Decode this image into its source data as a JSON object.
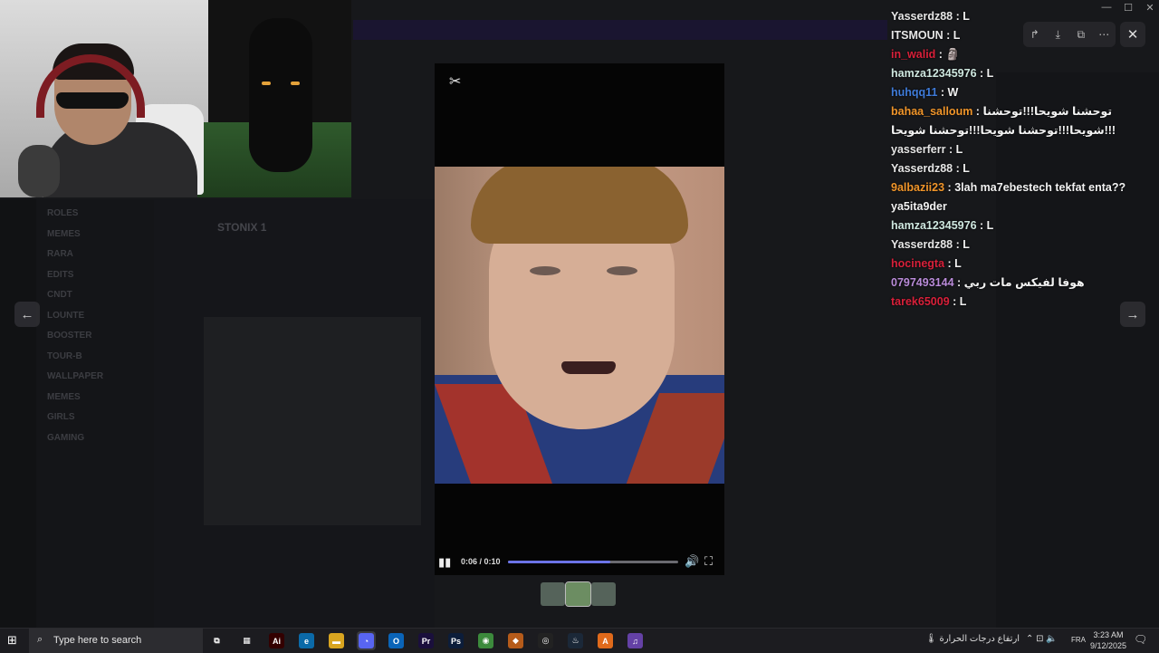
{
  "background_app": {
    "title": "STONIX 1",
    "channels": [
      "ROLES",
      "MEMES",
      "RARA",
      "EDITS",
      "CNDT",
      "LOUNTE",
      "BOOSTER",
      "TOUR-B",
      "WALLPAPER",
      "MEMES",
      "GIRLS",
      "GAMING"
    ]
  },
  "chat": {
    "messages": [
      {
        "user": "Yasserdz88",
        "color": "#e6e6e6",
        "text": "L"
      },
      {
        "user": "ITSMOUN",
        "color": "#e6e6e6",
        "text": "L"
      },
      {
        "user": "in_walid",
        "color": "#d8203a",
        "text": "🗿"
      },
      {
        "user": "hamza12345976",
        "color": "#cfe8e0",
        "text": "L"
      },
      {
        "user": "huhqq11",
        "color": "#3f7bd9",
        "text": "W"
      },
      {
        "user": "bahaa_salloum",
        "color": "#f0952a",
        "text": "توحشنا شويحا!!!توحشنا شويحا!!!توحشنا شويحا!!!توحشنا شويحا!!!"
      },
      {
        "user": "yasserferr",
        "color": "#e6e6e6",
        "text": "L"
      },
      {
        "user": "Yasserdz88",
        "color": "#e6e6e6",
        "text": "L"
      },
      {
        "user": "9albazii23",
        "color": "#f0952a",
        "text": "3lah ma7ebestech tekfat enta??ya5ita9der"
      },
      {
        "user": "hamza12345976",
        "color": "#cfe8e0",
        "text": "L"
      },
      {
        "user": "Yasserdz88",
        "color": "#e6e6e6",
        "text": "L"
      },
      {
        "user": "hocinegta",
        "color": "#d8203a",
        "text": "L"
      },
      {
        "user": "0797493144",
        "color": "#b98bd9",
        "text": "هوفا لفيكس مات ربي"
      },
      {
        "user": "tarek65009",
        "color": "#d8203a",
        "text": "L"
      }
    ]
  },
  "viewer": {
    "tools": [
      "share-icon",
      "download-icon",
      "open-external-icon",
      "more-icon"
    ],
    "close_glyph": "✕",
    "prev_glyph": "←",
    "next_glyph": "→"
  },
  "player": {
    "logo_glyph": "✂",
    "time": "0:06 / 0:10",
    "progress": 0.6,
    "accent": "#6b74e8"
  },
  "taskbar": {
    "search_placeholder": "Type here to search",
    "apps": [
      {
        "name": "task-view",
        "label": "⧉",
        "bg": "transparent"
      },
      {
        "name": "store",
        "label": "▦",
        "bg": "transparent"
      },
      {
        "name": "illustrator",
        "label": "Ai",
        "bg": "#330000"
      },
      {
        "name": "edge",
        "label": "e",
        "bg": "#0b6aa8"
      },
      {
        "name": "explorer",
        "label": "▬",
        "bg": "#d9a520"
      },
      {
        "name": "discord",
        "label": "◔",
        "bg": "#5865f2"
      },
      {
        "name": "outlook",
        "label": "O",
        "bg": "#0a64b8"
      },
      {
        "name": "premiere",
        "label": "Pr",
        "bg": "#1a0f3c"
      },
      {
        "name": "photoshop",
        "label": "Ps",
        "bg": "#0c1d3a"
      },
      {
        "name": "chrome",
        "label": "◉",
        "bg": "#3c8a3c"
      },
      {
        "name": "app-orange",
        "label": "◆",
        "bg": "#b55b1a"
      },
      {
        "name": "obs",
        "label": "◎",
        "bg": "#222"
      },
      {
        "name": "steam",
        "label": "♨",
        "bg": "#1b2838"
      },
      {
        "name": "app-a",
        "label": "A",
        "bg": "#e06a1b"
      },
      {
        "name": "twitch",
        "label": "♫",
        "bg": "#6441a5"
      }
    ],
    "weather": "ارتفاع درجات الحرارة",
    "language": "FRA",
    "time": "3:23 AM",
    "date": "9/12/2025",
    "notification_count": "3"
  }
}
